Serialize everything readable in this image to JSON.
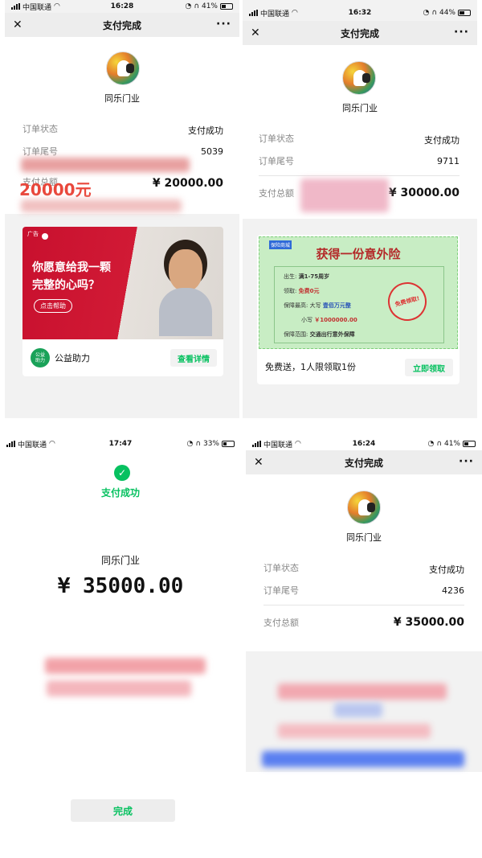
{
  "panels": [
    {
      "status": {
        "carrier": "中国联通",
        "time": "16:28",
        "battery": "41%",
        "battery_level": 0.41
      },
      "nav": {
        "title": "支付完成",
        "close": "✕",
        "more": "···"
      },
      "merchant": "同乐门业",
      "rows": [
        {
          "label": "订单状态",
          "value": "支付成功"
        },
        {
          "label": "订单尾号",
          "value": "5039"
        },
        {
          "label": "支付总额",
          "value": "¥ 20000.00"
        }
      ],
      "overlay_amount": "20000元",
      "ad": {
        "tag": "广告",
        "headline_1": "你愿意给我一颗",
        "headline_2": "完整的心吗？",
        "cta": "点击帮助",
        "brand_icon_text": "公益\n助力",
        "brand": "公益助力",
        "detail_button": "查看详情"
      }
    },
    {
      "status": {
        "carrier": "中国联通",
        "time": "16:32",
        "battery": "44%",
        "battery_level": 0.44
      },
      "nav": {
        "title": "支付完成",
        "close": "✕",
        "more": "···"
      },
      "merchant": "同乐门业",
      "rows": [
        {
          "label": "订单状态",
          "value": "支付成功"
        },
        {
          "label": "订单尾号",
          "value": "9711"
        },
        {
          "label": "支付总额",
          "value": "¥ 30000.00"
        }
      ],
      "insurance": {
        "tag": "保险商城",
        "title": "获得一份意外险",
        "lines": [
          {
            "label": "出生:",
            "value": "满1-75周岁"
          },
          {
            "label": "领取:",
            "value": "免费0元"
          },
          {
            "label": "保障最高: 大写",
            "value": "壹佰万元整"
          },
          {
            "label": "小写",
            "value": "￥1000000.00"
          },
          {
            "label": "保障范围:",
            "value": "交通出行意外保障"
          }
        ],
        "stamp": "免费领取!",
        "footer_text": "免费送，1人限领取1份",
        "claim_button": "立即领取"
      }
    },
    {
      "status": {
        "carrier": "中国联通",
        "time": "17:47",
        "battery": "33%",
        "battery_level": 0.33
      },
      "success_text": "支付成功",
      "merchant": "同乐门业",
      "amount": "¥ 35000.00",
      "done_button": "完成"
    },
    {
      "status": {
        "carrier": "中国联通",
        "time": "16:24",
        "battery": "41%",
        "battery_level": 0.41
      },
      "nav": {
        "title": "支付完成",
        "close": "✕",
        "more": "···"
      },
      "merchant": "同乐门业",
      "rows": [
        {
          "label": "订单状态",
          "value": "支付成功"
        },
        {
          "label": "订单尾号",
          "value": "4236"
        },
        {
          "label": "支付总额",
          "value": "¥ 35000.00"
        }
      ]
    }
  ],
  "colors": {
    "wechat_green": "#07c160",
    "red": "#e9473b",
    "ad_red": "#c8102e"
  }
}
